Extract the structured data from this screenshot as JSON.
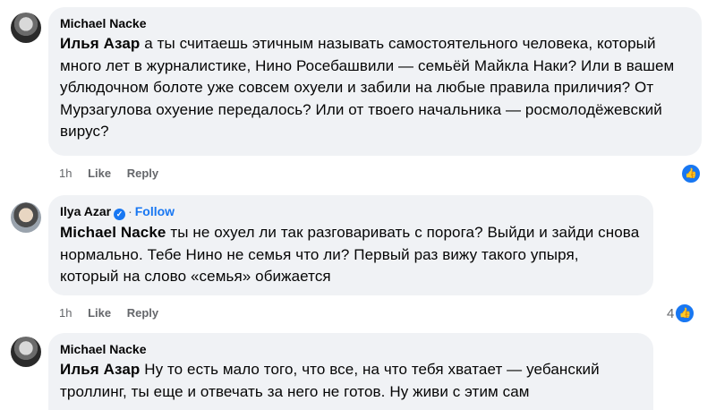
{
  "comments": [
    {
      "author": "Michael Nacke",
      "mention": "Илья Азар",
      "text": "а ты считаешь этичным называть самостоятельного человека, который много лет в журналистике, Нино Росебашвили — семьёй Майкла Наки? Или в вашем ублюдочном болоте уже совсем охуели и забили на любые правила приличия? От Мурзагулова охуение передалось? Или от твоего начальника — росмолодёжевский вирус?",
      "time": "1h",
      "like": "Like",
      "reply": "Reply",
      "reactions": ""
    },
    {
      "author": "Ilya Azar",
      "verified": "✓",
      "follow": "Follow",
      "mention": "Michael Nacke",
      "text": "ты не охуел ли так разговаривать с порога? Выйди и зайди снова нормально. Тебе Нино не семья что ли? Первый раз вижу такого упыря, который на слово «семья» обижается",
      "time": "1h",
      "like": "Like",
      "reply": "Reply",
      "reactions": "4"
    },
    {
      "author": "Michael Nacke",
      "mention": "Илья Азар",
      "text": "Ну то есть мало того, что все, на что тебя хватает — уебанский троллинг, ты еще и отвечать за него не готов. Ну живи с этим сам"
    }
  ],
  "icons": {
    "like": "thumbs-up-icon",
    "verified": "verified-badge-icon"
  },
  "colors": {
    "accent": "#1877f2",
    "bubble": "#f0f2f5",
    "muted": "#65676b"
  }
}
